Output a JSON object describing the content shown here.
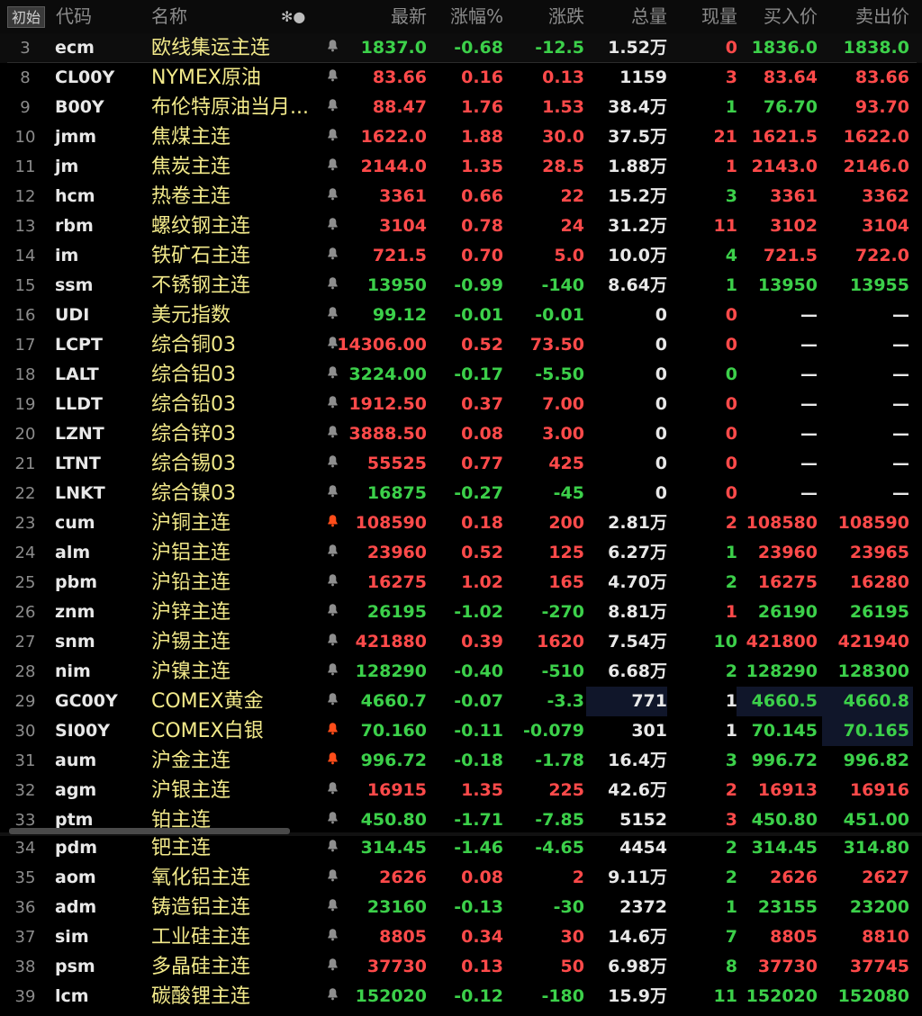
{
  "header": {
    "start_btn": "初始",
    "code": "代码",
    "name": "名称",
    "settings_glyph": "✻●",
    "last": "最新",
    "pct": "涨幅%",
    "chg": "涨跌",
    "vol": "总量",
    "cur": "现量",
    "bid": "买入价",
    "ask": "卖出价"
  },
  "colors": {
    "up": "#ff4a4a",
    "down": "#3cd04a",
    "neutral": "#e8e8e8",
    "name": "#f2e98a",
    "alert_bell": "#ff4d1a"
  },
  "rows": [
    {
      "num": "3",
      "code": "ecm",
      "name": "欧线集运主连",
      "bell": "bell-icon",
      "last": "1837.0",
      "pct": "-0.68",
      "chg": "-12.5",
      "vol": "1.52万",
      "cur": "0",
      "bid": "1836.0",
      "ask": "1838.0",
      "dir": "green",
      "cur_c": "red",
      "bid_c": "green",
      "ask_c": "green"
    },
    {
      "num": "8",
      "code": "CL00Y",
      "name": "NYMEX原油",
      "bell": "bell-icon",
      "last": "83.66",
      "pct": "0.16",
      "chg": "0.13",
      "vol": "1159",
      "cur": "3",
      "bid": "83.64",
      "ask": "83.66",
      "dir": "red",
      "cur_c": "red",
      "bid_c": "red",
      "ask_c": "red"
    },
    {
      "num": "9",
      "code": "B00Y",
      "name": "布伦特原油当月...",
      "bell": "bell-icon",
      "last": "88.47",
      "pct": "1.76",
      "chg": "1.53",
      "vol": "38.4万",
      "cur": "1",
      "bid": "76.70",
      "ask": "93.70",
      "dir": "red",
      "cur_c": "green",
      "bid_c": "green",
      "ask_c": "red"
    },
    {
      "num": "10",
      "code": "jmm",
      "name": "焦煤主连",
      "bell": "bell-icon",
      "last": "1622.0",
      "pct": "1.88",
      "chg": "30.0",
      "vol": "37.5万",
      "cur": "21",
      "bid": "1621.5",
      "ask": "1622.0",
      "dir": "red",
      "cur_c": "red",
      "bid_c": "red",
      "ask_c": "red"
    },
    {
      "num": "11",
      "code": "jm",
      "name": "焦炭主连",
      "bell": "bell-icon",
      "last": "2144.0",
      "pct": "1.35",
      "chg": "28.5",
      "vol": "1.88万",
      "cur": "1",
      "bid": "2143.0",
      "ask": "2146.0",
      "dir": "red",
      "cur_c": "red",
      "bid_c": "red",
      "ask_c": "red"
    },
    {
      "num": "12",
      "code": "hcm",
      "name": "热卷主连",
      "bell": "bell-icon",
      "last": "3361",
      "pct": "0.66",
      "chg": "22",
      "vol": "15.2万",
      "cur": "3",
      "bid": "3361",
      "ask": "3362",
      "dir": "red",
      "cur_c": "green",
      "bid_c": "red",
      "ask_c": "red"
    },
    {
      "num": "13",
      "code": "rbm",
      "name": "螺纹钢主连",
      "bell": "bell-icon",
      "last": "3104",
      "pct": "0.78",
      "chg": "24",
      "vol": "31.2万",
      "cur": "11",
      "bid": "3102",
      "ask": "3104",
      "dir": "red",
      "cur_c": "red",
      "bid_c": "red",
      "ask_c": "red"
    },
    {
      "num": "14",
      "code": "im",
      "name": "铁矿石主连",
      "bell": "bell-icon",
      "last": "721.5",
      "pct": "0.70",
      "chg": "5.0",
      "vol": "10.0万",
      "cur": "4",
      "bid": "721.5",
      "ask": "722.0",
      "dir": "red",
      "cur_c": "green",
      "bid_c": "red",
      "ask_c": "red"
    },
    {
      "num": "15",
      "code": "ssm",
      "name": "不锈钢主连",
      "bell": "bell-icon",
      "last": "13950",
      "pct": "-0.99",
      "chg": "-140",
      "vol": "8.64万",
      "cur": "1",
      "bid": "13950",
      "ask": "13955",
      "dir": "green",
      "cur_c": "green",
      "bid_c": "green",
      "ask_c": "green"
    },
    {
      "num": "16",
      "code": "UDI",
      "name": "美元指数",
      "bell": "bell-icon",
      "last": "99.12",
      "pct": "-0.01",
      "chg": "-0.01",
      "vol": "0",
      "cur": "0",
      "bid": "—",
      "ask": "—",
      "dir": "green",
      "cur_c": "red",
      "bid_c": "white",
      "ask_c": "white"
    },
    {
      "num": "17",
      "code": "LCPT",
      "name": "综合铜03",
      "bell": "bell-icon",
      "last": "14306.00",
      "pct": "0.52",
      "chg": "73.50",
      "vol": "0",
      "cur": "0",
      "bid": "—",
      "ask": "—",
      "dir": "red",
      "cur_c": "red",
      "bid_c": "white",
      "ask_c": "white"
    },
    {
      "num": "18",
      "code": "LALT",
      "name": "综合铝03",
      "bell": "bell-icon",
      "last": "3224.00",
      "pct": "-0.17",
      "chg": "-5.50",
      "vol": "0",
      "cur": "0",
      "bid": "—",
      "ask": "—",
      "dir": "green",
      "cur_c": "green",
      "bid_c": "white",
      "ask_c": "white"
    },
    {
      "num": "19",
      "code": "LLDT",
      "name": "综合铅03",
      "bell": "bell-icon",
      "last": "1912.50",
      "pct": "0.37",
      "chg": "7.00",
      "vol": "0",
      "cur": "0",
      "bid": "—",
      "ask": "—",
      "dir": "red",
      "cur_c": "red",
      "bid_c": "white",
      "ask_c": "white"
    },
    {
      "num": "20",
      "code": "LZNT",
      "name": "综合锌03",
      "bell": "bell-icon",
      "last": "3888.50",
      "pct": "0.08",
      "chg": "3.00",
      "vol": "0",
      "cur": "0",
      "bid": "—",
      "ask": "—",
      "dir": "red",
      "cur_c": "red",
      "bid_c": "white",
      "ask_c": "white"
    },
    {
      "num": "21",
      "code": "LTNT",
      "name": "综合锡03",
      "bell": "bell-icon",
      "last": "55525",
      "pct": "0.77",
      "chg": "425",
      "vol": "0",
      "cur": "0",
      "bid": "—",
      "ask": "—",
      "dir": "red",
      "cur_c": "red",
      "bid_c": "white",
      "ask_c": "white"
    },
    {
      "num": "22",
      "code": "LNKT",
      "name": "综合镍03",
      "bell": "bell-icon",
      "last": "16875",
      "pct": "-0.27",
      "chg": "-45",
      "vol": "0",
      "cur": "0",
      "bid": "—",
      "ask": "—",
      "dir": "green",
      "cur_c": "red",
      "bid_c": "white",
      "ask_c": "white"
    },
    {
      "num": "23",
      "code": "cum",
      "name": "沪铜主连",
      "bell": "bell-alert-icon",
      "last": "108590",
      "pct": "0.18",
      "chg": "200",
      "vol": "2.81万",
      "cur": "2",
      "bid": "108580",
      "ask": "108590",
      "dir": "red",
      "cur_c": "red",
      "bid_c": "red",
      "ask_c": "red"
    },
    {
      "num": "24",
      "code": "alm",
      "name": "沪铝主连",
      "bell": "bell-icon",
      "last": "23960",
      "pct": "0.52",
      "chg": "125",
      "vol": "6.27万",
      "cur": "1",
      "bid": "23960",
      "ask": "23965",
      "dir": "red",
      "cur_c": "green",
      "bid_c": "red",
      "ask_c": "red"
    },
    {
      "num": "25",
      "code": "pbm",
      "name": "沪铅主连",
      "bell": "bell-icon",
      "last": "16275",
      "pct": "1.02",
      "chg": "165",
      "vol": "4.70万",
      "cur": "2",
      "bid": "16275",
      "ask": "16280",
      "dir": "red",
      "cur_c": "green",
      "bid_c": "red",
      "ask_c": "red"
    },
    {
      "num": "26",
      "code": "znm",
      "name": "沪锌主连",
      "bell": "bell-icon",
      "last": "26195",
      "pct": "-1.02",
      "chg": "-270",
      "vol": "8.81万",
      "cur": "1",
      "bid": "26190",
      "ask": "26195",
      "dir": "green",
      "cur_c": "red",
      "bid_c": "green",
      "ask_c": "green"
    },
    {
      "num": "27",
      "code": "snm",
      "name": "沪锡主连",
      "bell": "bell-icon",
      "last": "421880",
      "pct": "0.39",
      "chg": "1620",
      "vol": "7.54万",
      "cur": "10",
      "bid": "421800",
      "ask": "421940",
      "dir": "red",
      "cur_c": "green",
      "bid_c": "red",
      "ask_c": "red"
    },
    {
      "num": "28",
      "code": "nim",
      "name": "沪镍主连",
      "bell": "bell-icon",
      "last": "128290",
      "pct": "-0.40",
      "chg": "-510",
      "vol": "6.68万",
      "cur": "2",
      "bid": "128290",
      "ask": "128300",
      "dir": "green",
      "cur_c": "green",
      "bid_c": "green",
      "ask_c": "green"
    },
    {
      "num": "29",
      "code": "GC00Y",
      "name": "COMEX黄金",
      "bell": "bell-icon",
      "last": "4660.7",
      "pct": "-0.07",
      "chg": "-3.3",
      "vol": "771",
      "cur": "1",
      "bid": "4660.5",
      "ask": "4660.8",
      "dir": "green",
      "cur_c": "white",
      "bid_c": "green",
      "ask_c": "green",
      "hl": "vol-bid-ask"
    },
    {
      "num": "30",
      "code": "SI00Y",
      "name": "COMEX白银",
      "bell": "bell-alert-icon",
      "last": "70.160",
      "pct": "-0.11",
      "chg": "-0.079",
      "vol": "301",
      "cur": "1",
      "bid": "70.145",
      "ask": "70.165",
      "dir": "green",
      "cur_c": "white",
      "bid_c": "green",
      "ask_c": "green",
      "hl": "ask"
    },
    {
      "num": "31",
      "code": "aum",
      "name": "沪金主连",
      "bell": "bell-alert-icon",
      "last": "996.72",
      "pct": "-0.18",
      "chg": "-1.78",
      "vol": "16.4万",
      "cur": "3",
      "bid": "996.72",
      "ask": "996.82",
      "dir": "green",
      "cur_c": "green",
      "bid_c": "green",
      "ask_c": "green"
    },
    {
      "num": "32",
      "code": "agm",
      "name": "沪银主连",
      "bell": "bell-icon",
      "last": "16915",
      "pct": "1.35",
      "chg": "225",
      "vol": "42.6万",
      "cur": "2",
      "bid": "16913",
      "ask": "16916",
      "dir": "red",
      "cur_c": "red",
      "bid_c": "red",
      "ask_c": "red"
    },
    {
      "num": "33",
      "code": "ptm",
      "name": "铂主连",
      "bell": "bell-icon",
      "last": "450.80",
      "pct": "-1.71",
      "chg": "-7.85",
      "vol": "5152",
      "cur": "3",
      "bid": "450.80",
      "ask": "451.00",
      "dir": "green",
      "cur_c": "red",
      "bid_c": "green",
      "ask_c": "green"
    },
    {
      "num": "34",
      "code": "pdm",
      "name": "钯主连",
      "bell": "bell-icon",
      "last": "314.45",
      "pct": "-1.46",
      "chg": "-4.65",
      "vol": "4454",
      "cur": "2",
      "bid": "314.45",
      "ask": "314.80",
      "dir": "green",
      "cur_c": "green",
      "bid_c": "green",
      "ask_c": "green"
    },
    {
      "num": "35",
      "code": "aom",
      "name": "氧化铝主连",
      "bell": "bell-icon",
      "last": "2626",
      "pct": "0.08",
      "chg": "2",
      "vol": "9.11万",
      "cur": "2",
      "bid": "2626",
      "ask": "2627",
      "dir": "red",
      "cur_c": "green",
      "bid_c": "red",
      "ask_c": "red"
    },
    {
      "num": "36",
      "code": "adm",
      "name": "铸造铝主连",
      "bell": "bell-icon",
      "last": "23160",
      "pct": "-0.13",
      "chg": "-30",
      "vol": "2372",
      "cur": "1",
      "bid": "23155",
      "ask": "23200",
      "dir": "green",
      "cur_c": "green",
      "bid_c": "green",
      "ask_c": "green"
    },
    {
      "num": "37",
      "code": "sim",
      "name": "工业硅主连",
      "bell": "bell-icon",
      "last": "8805",
      "pct": "0.34",
      "chg": "30",
      "vol": "14.6万",
      "cur": "7",
      "bid": "8805",
      "ask": "8810",
      "dir": "red",
      "cur_c": "green",
      "bid_c": "red",
      "ask_c": "red"
    },
    {
      "num": "38",
      "code": "psm",
      "name": "多晶硅主连",
      "bell": "bell-icon",
      "last": "37730",
      "pct": "0.13",
      "chg": "50",
      "vol": "6.98万",
      "cur": "8",
      "bid": "37730",
      "ask": "37745",
      "dir": "red",
      "cur_c": "green",
      "bid_c": "red",
      "ask_c": "red"
    },
    {
      "num": "39",
      "code": "lcm",
      "name": "碳酸锂主连",
      "bell": "bell-icon",
      "last": "152020",
      "pct": "-0.12",
      "chg": "-180",
      "vol": "15.9万",
      "cur": "11",
      "bid": "152020",
      "ask": "152080",
      "dir": "green",
      "cur_c": "green",
      "bid_c": "green",
      "ask_c": "green"
    }
  ]
}
